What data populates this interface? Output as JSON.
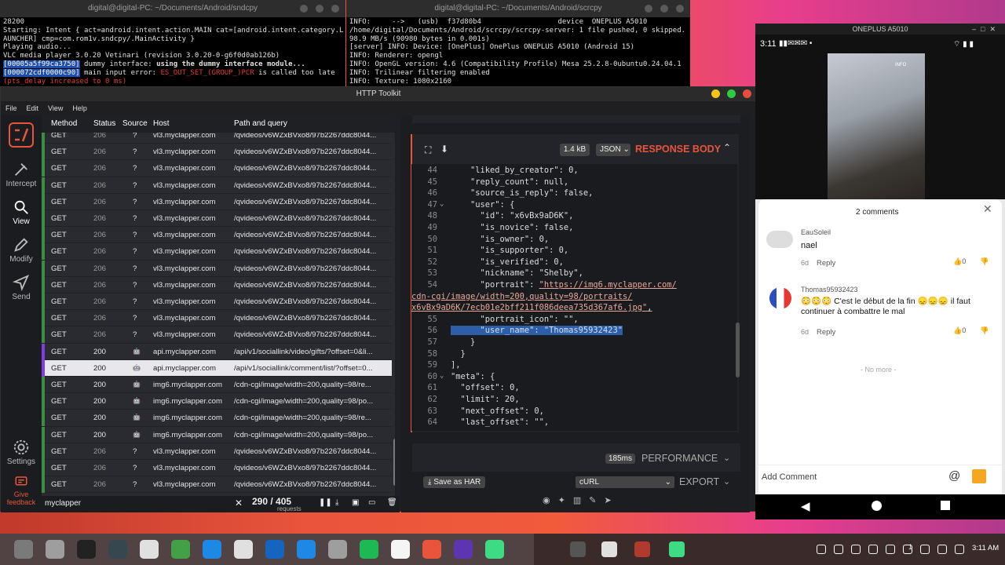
{
  "term1": {
    "title": "digital@digital-PC: ~/Documents/Android/sndcpy",
    "lines": [
      "28200",
      "Starting: Intent { act=android.intent.action.MAIN cat=[android.intent.category.L",
      "AUNCHER] cmp=com.rom1v.sndcpy/.MainActivity }",
      "Playing audio...",
      "VLC media player 3.0.20 Vetinari (revision 3.0.20-0-g6f0d0ab126b)"
    ],
    "l6_addr": "[00005a5f99ca3750]",
    "l6_mid": " dummy interface: ",
    "l6_bold": "using the dummy interface module...",
    "l7_addr": "[000072cdf0000c90]",
    "l7_mid": " main input error: ",
    "l7_red": "ES_OUT_SET_(GROUP_)PCR",
    "l7_end": " is called too late",
    "l8": "(pts_delay increased to 0 ms)"
  },
  "term2": {
    "title": "digital@digital-PC: ~/Documents/Android/scrcpy",
    "lines": [
      "INFO:     -->   (usb)  f37d80b4                  device  ONEPLUS A5010",
      "/home/digital/Documents/Android/scrcpy/scrcpy-server: 1 file pushed, 0 skipped.",
      "98.9 MB/s (90980 bytes in 0.001s)",
      "[server] INFO: Device: [OnePlus] OnePlus ONEPLUS A5010 (Android 15)",
      "INFO: Renderer: opengl",
      "INFO: OpenGL version: 4.6 (Compatibility Profile) Mesa 25.2.8-0ubuntu0.24.04.1",
      "INFO: Trilinear filtering enabled",
      "INFO: Texture: 1080x2160"
    ]
  },
  "htk": {
    "title": "HTTP Toolkit",
    "menu": [
      "File",
      "Edit",
      "View",
      "Help"
    ],
    "sidebar": [
      "Intercept",
      "View",
      "Modify",
      "Send",
      "Settings",
      "Give feedback"
    ],
    "columns": [
      "Method",
      "Status",
      "Source",
      "Host",
      "Path and query"
    ],
    "rows": [
      {
        "method": "GET",
        "status": "206",
        "source": "?",
        "host": "vl3.myclapper.com",
        "path": "/qvideos/v6WZxBVxo8/97b2267ddc8044...",
        "kind": "video"
      },
      {
        "method": "GET",
        "status": "206",
        "source": "?",
        "host": "vl3.myclapper.com",
        "path": "/qvideos/v6WZxBVxo8/97b2267ddc8044...",
        "kind": "video"
      },
      {
        "method": "GET",
        "status": "206",
        "source": "?",
        "host": "vl3.myclapper.com",
        "path": "/qvideos/v6WZxBVxo8/97b2267ddc8044...",
        "kind": "video"
      },
      {
        "method": "GET",
        "status": "206",
        "source": "?",
        "host": "vl3.myclapper.com",
        "path": "/qvideos/v6WZxBVxo8/97b2267ddc8044...",
        "kind": "video"
      },
      {
        "method": "GET",
        "status": "206",
        "source": "?",
        "host": "vl3.myclapper.com",
        "path": "/qvideos/v6WZxBVxo8/97b2267ddc8044...",
        "kind": "video"
      },
      {
        "method": "GET",
        "status": "206",
        "source": "?",
        "host": "vl3.myclapper.com",
        "path": "/qvideos/v6WZxBVxo8/97b2267ddc8044...",
        "kind": "video"
      },
      {
        "method": "GET",
        "status": "206",
        "source": "?",
        "host": "vl3.myclapper.com",
        "path": "/qvideos/v6WZxBVxo8/97b2267ddc8044...",
        "kind": "video"
      },
      {
        "method": "GET",
        "status": "206",
        "source": "?",
        "host": "vl3.myclapper.com",
        "path": "/qvideos/v6WZxBVxo8/97b2267ddc8044...",
        "kind": "video"
      },
      {
        "method": "GET",
        "status": "206",
        "source": "?",
        "host": "vl3.myclapper.com",
        "path": "/qvideos/v6WZxBVxo8/97b2267ddc8044...",
        "kind": "video"
      },
      {
        "method": "GET",
        "status": "206",
        "source": "?",
        "host": "vl3.myclapper.com",
        "path": "/qvideos/v6WZxBVxo8/97b2267ddc8044...",
        "kind": "video"
      },
      {
        "method": "GET",
        "status": "206",
        "source": "?",
        "host": "vl3.myclapper.com",
        "path": "/qvideos/v6WZxBVxo8/97b2267ddc8044...",
        "kind": "video"
      },
      {
        "method": "GET",
        "status": "206",
        "source": "?",
        "host": "vl3.myclapper.com",
        "path": "/qvideos/v6WZxBVxo8/97b2267ddc8044...",
        "kind": "video"
      },
      {
        "method": "GET",
        "status": "206",
        "source": "?",
        "host": "vl3.myclapper.com",
        "path": "/qvideos/v6WZxBVxo8/97b2267ddc8044...",
        "kind": "video"
      },
      {
        "method": "GET",
        "status": "200",
        "source": "android",
        "host": "api.myclapper.com",
        "path": "/api/v1/sociallink/video/gifts/?offset=0&li...",
        "kind": "api"
      },
      {
        "method": "GET",
        "status": "200",
        "source": "android",
        "host": "api.myclapper.com",
        "path": "/api/v1/sociallink/comment/list/?offset=0...",
        "kind": "api",
        "selected": true
      },
      {
        "method": "GET",
        "status": "200",
        "source": "android",
        "host": "img6.myclapper.com",
        "path": "/cdn-cgi/image/width=200,quality=98/re...",
        "kind": "img"
      },
      {
        "method": "GET",
        "status": "200",
        "source": "android",
        "host": "img6.myclapper.com",
        "path": "/cdn-cgi/image/width=200,quality=98/po...",
        "kind": "img"
      },
      {
        "method": "GET",
        "status": "200",
        "source": "android",
        "host": "img6.myclapper.com",
        "path": "/cdn-cgi/image/width=200,quality=98/re...",
        "kind": "img"
      },
      {
        "method": "GET",
        "status": "200",
        "source": "android",
        "host": "img6.myclapper.com",
        "path": "/cdn-cgi/image/width=200,quality=98/po...",
        "kind": "img"
      },
      {
        "method": "GET",
        "status": "206",
        "source": "?",
        "host": "vl3.myclapper.com",
        "path": "/qvideos/v6WZxBVxo8/97b2267ddc8044...",
        "kind": "video"
      },
      {
        "method": "GET",
        "status": "206",
        "source": "?",
        "host": "vl3.myclapper.com",
        "path": "/qvideos/v6WZxBVxo8/97b2267ddc8044...",
        "kind": "video"
      },
      {
        "method": "GET",
        "status": "206",
        "source": "?",
        "host": "vl3.myclapper.com",
        "path": "/qvideos/v6WZxBVxo8/97b2267ddc8044...",
        "kind": "video"
      }
    ],
    "filter_value": "myclapper",
    "count": "290 / 405",
    "count_label": "requests",
    "response": {
      "size": "1.4 kB",
      "format": "JSON",
      "label": "RESPONSE BODY"
    },
    "code_lines": [
      {
        "n": "44",
        "t": "    \"liked_by_creator\": 0,"
      },
      {
        "n": "45",
        "t": "    \"reply_count\": null,"
      },
      {
        "n": "46",
        "t": "    \"source_is_reply\": false,"
      },
      {
        "n": "47",
        "t": "    \"user\": {",
        "fold": true
      },
      {
        "n": "48",
        "t": "      \"id\": \"x6vBx9aD6K\","
      },
      {
        "n": "49",
        "t": "      \"is_novice\": false,"
      },
      {
        "n": "50",
        "t": "      \"is_owner\": 0,"
      },
      {
        "n": "51",
        "t": "      \"is_supporter\": 0,"
      },
      {
        "n": "52",
        "t": "      \"is_verified\": 0,"
      },
      {
        "n": "53",
        "t": "      \"nickname\": \"Shelby\","
      },
      {
        "n": "54",
        "t": "      \"portrait\": "
      }
    ],
    "portrait_url_1": "\"https://img6.myclapper.com/",
    "portrait_url_2": "cdn-cgi/image/width=200,quality=98/portraits/",
    "portrait_url_3": "x6vBx9aD6K/7ecb01e2bff211f086deea735d367af6.jpg\"",
    "code_lines_b": [
      {
        "n": "55",
        "t": "      \"portrait_icon\": \"\","
      },
      {
        "n": "56",
        "t": "      \"user_name\": \"Thomas95932423\"",
        "sel": true
      },
      {
        "n": "57",
        "t": "    }"
      },
      {
        "n": "58",
        "t": "  }"
      },
      {
        "n": "59",
        "t": "],"
      },
      {
        "n": "60",
        "t": "\"meta\": {",
        "fold": true
      },
      {
        "n": "61",
        "t": "  \"offset\": 0,"
      },
      {
        "n": "62",
        "t": "  \"limit\": 20,"
      },
      {
        "n": "63",
        "t": "  \"next_offset\": 0,"
      },
      {
        "n": "64",
        "t": "  \"last_offset\": \"\","
      }
    ],
    "perf_time": "185ms",
    "perf_label": "PERFORMANCE",
    "save_har": "Save as HAR",
    "export_format": "cURL",
    "export_label": "EXPORT"
  },
  "phone": {
    "title": "ONEPLUS A5010",
    "time": "3:11",
    "comments_title": "2 comments",
    "c1_user": "EauSoleil",
    "c1_text": "nael",
    "c1_age": "6d",
    "c1_reply": "Reply",
    "c1_likes": "0",
    "c2_user": "Thomas95932423",
    "c2_text": "😳😳😳 C'est le début de la fin 😞😞😞 il faut continuer à combattre le mal",
    "c2_age": "6d",
    "c2_reply": "Reply",
    "c2_likes": "0",
    "no_more": "- No more -",
    "add_comment": "Add Comment",
    "video_badge": "INFO"
  },
  "taskbar": {
    "time": "3:11 AM",
    "battery": "1"
  },
  "colors": {
    "accent": "#e8543c",
    "selected_row": "#e8e8ec",
    "video_marker": "#3a8f3a",
    "api_marker": "#7b3fe4",
    "img_marker": "#3a8f3a"
  }
}
